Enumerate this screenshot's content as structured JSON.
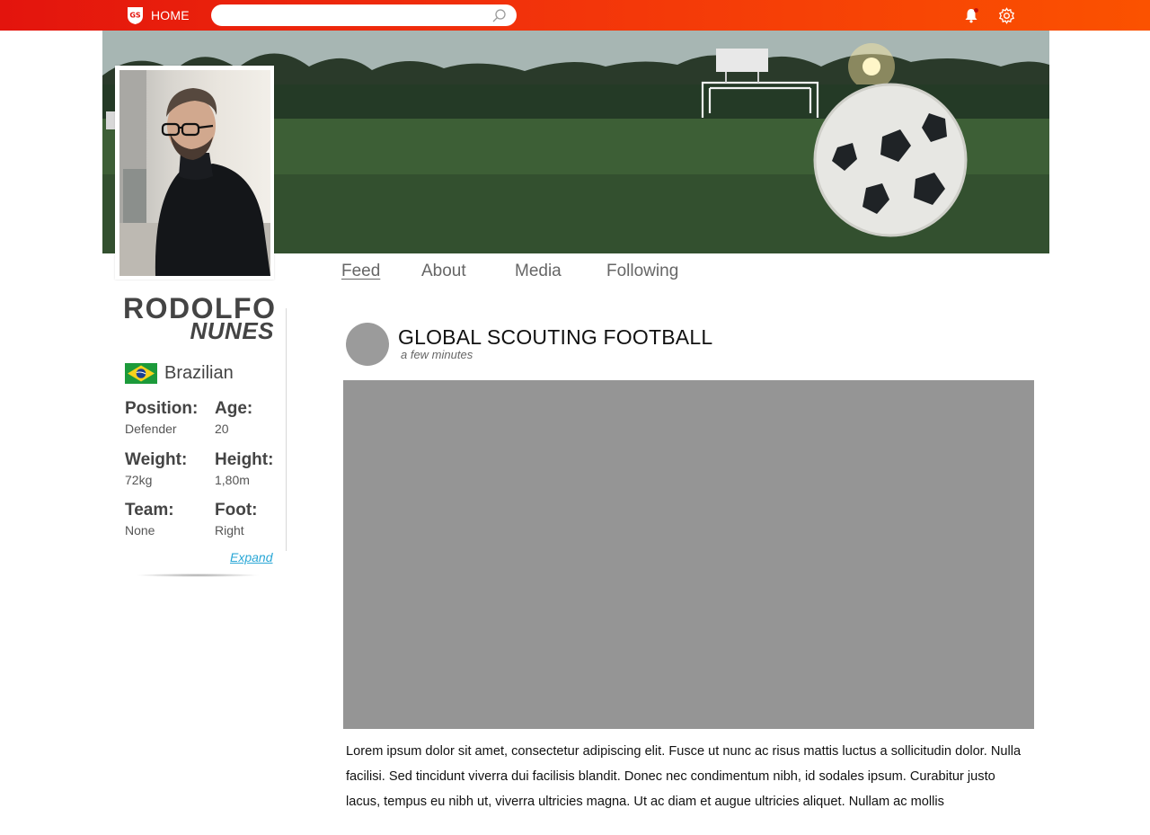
{
  "topbar": {
    "home_label": "HOME",
    "search_placeholder": "",
    "colors": {
      "gradient_start": "#e3140d",
      "gradient_end": "#fb5200"
    }
  },
  "profile": {
    "first_name": "RODOLFO",
    "last_name": "NUNES",
    "nationality": "Brazilian",
    "stats": {
      "position": {
        "label": "Position:",
        "value": "Defender"
      },
      "age": {
        "label": "Age:",
        "value": "20"
      },
      "weight": {
        "label": "Weight:",
        "value": "72kg"
      },
      "height": {
        "label": "Height:",
        "value": "1,80m"
      },
      "team": {
        "label": "Team:",
        "value": "None"
      },
      "foot": {
        "label": "Foot:",
        "value": "Right"
      }
    },
    "expand_label": "Expand"
  },
  "tabs": [
    {
      "label": "Feed",
      "active": true
    },
    {
      "label": "About",
      "active": false
    },
    {
      "label": "Media",
      "active": false
    },
    {
      "label": "Following",
      "active": false
    }
  ],
  "post": {
    "author": "GLOBAL SCOUTING FOOTBALL",
    "time": "a few minutes",
    "text": "Lorem ipsum dolor sit amet, consectetur adipiscing elit. Fusce ut nunc ac risus mattis luctus a sollicitudin dolor. Nulla facilisi. Sed tincidunt viverra dui facilisis blandit. Donec nec condimentum nibh, id sodales ipsum. Curabitur justo lacus, tempus eu nibh ut, viverra ultricies magna. Ut ac diam et augue ultricies aliquet. Nullam ac mollis"
  },
  "icons": [
    "logo-icon",
    "search-icon",
    "bell-icon",
    "gear-icon",
    "brazil-flag-icon"
  ]
}
